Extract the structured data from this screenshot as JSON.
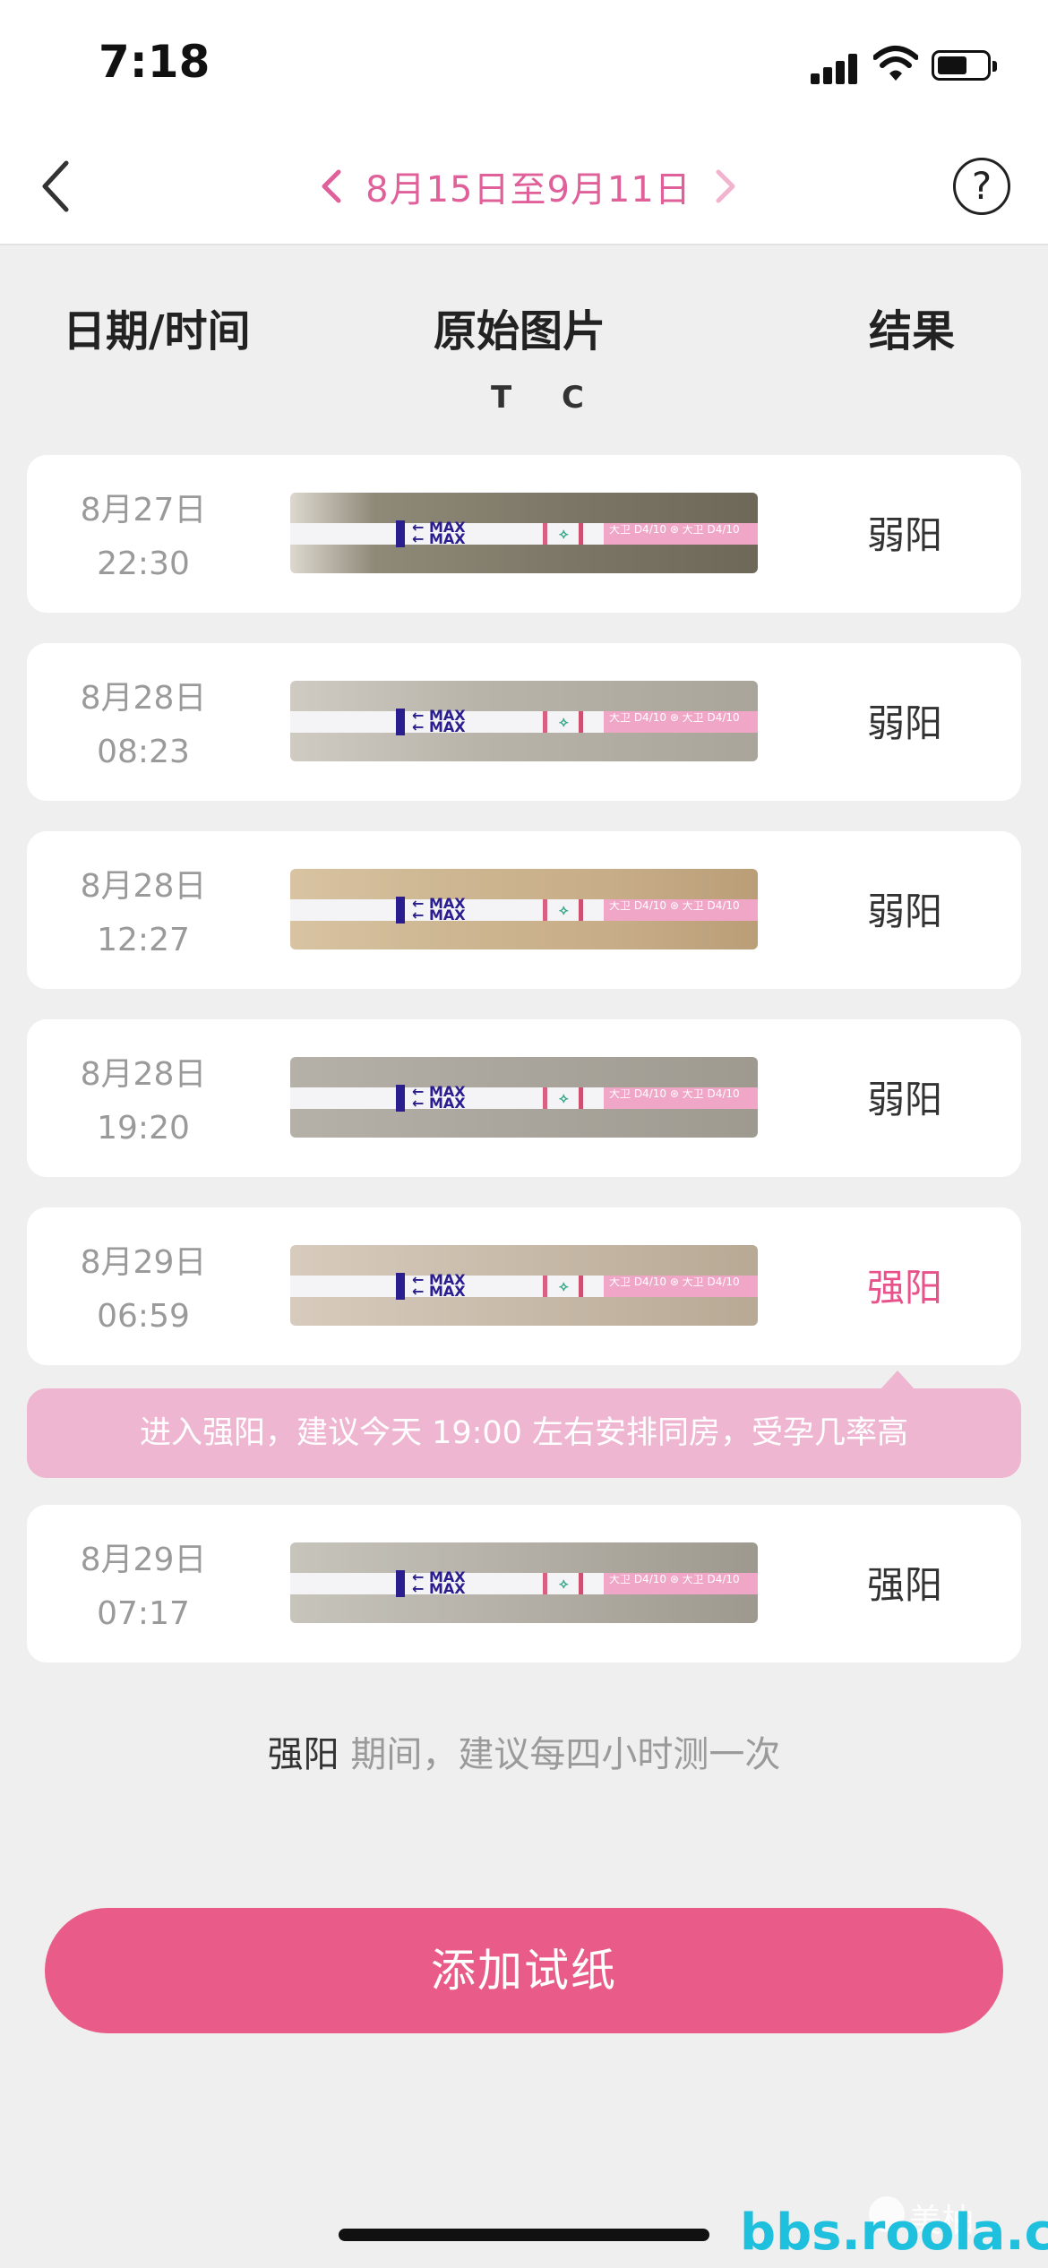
{
  "status_bar": {
    "time": "7:18"
  },
  "nav": {
    "date_range": "8月15日至9月11日",
    "help_label": "?"
  },
  "columns": {
    "date_time": "日期/时间",
    "image": "原始图片",
    "result": "结果",
    "tc": "T C"
  },
  "strip_text": {
    "max": "MAX",
    "pink_print": "大卫 D4/10 ⊛ 大卫 D4/10"
  },
  "records": [
    {
      "date": "8月27日",
      "time": "22:30",
      "result": "弱阳",
      "strong": false
    },
    {
      "date": "8月28日",
      "time": "08:23",
      "result": "弱阳",
      "strong": false
    },
    {
      "date": "8月28日",
      "time": "12:27",
      "result": "弱阳",
      "strong": false
    },
    {
      "date": "8月28日",
      "time": "19:20",
      "result": "弱阳",
      "strong": false
    },
    {
      "date": "8月29日",
      "time": "06:59",
      "result": "强阳",
      "strong": true
    },
    {
      "date": "8月29日",
      "time": "07:17",
      "result": "强阳",
      "strong": false
    }
  ],
  "tip": "进入强阳，建议今天 19:00 左右安排同房，受孕几率高",
  "hint": {
    "bold": "强阳",
    "rest": " 期间，建议每四小时测一次"
  },
  "add_button": "添加试纸",
  "watermark": {
    "brand": "美柚",
    "url": "bbs.roola.cn"
  },
  "colors": {
    "accent": "#e95b88",
    "strong_result": "#e8528a",
    "tip_bg": "#efb6d2",
    "date_range": "#e0609a"
  }
}
